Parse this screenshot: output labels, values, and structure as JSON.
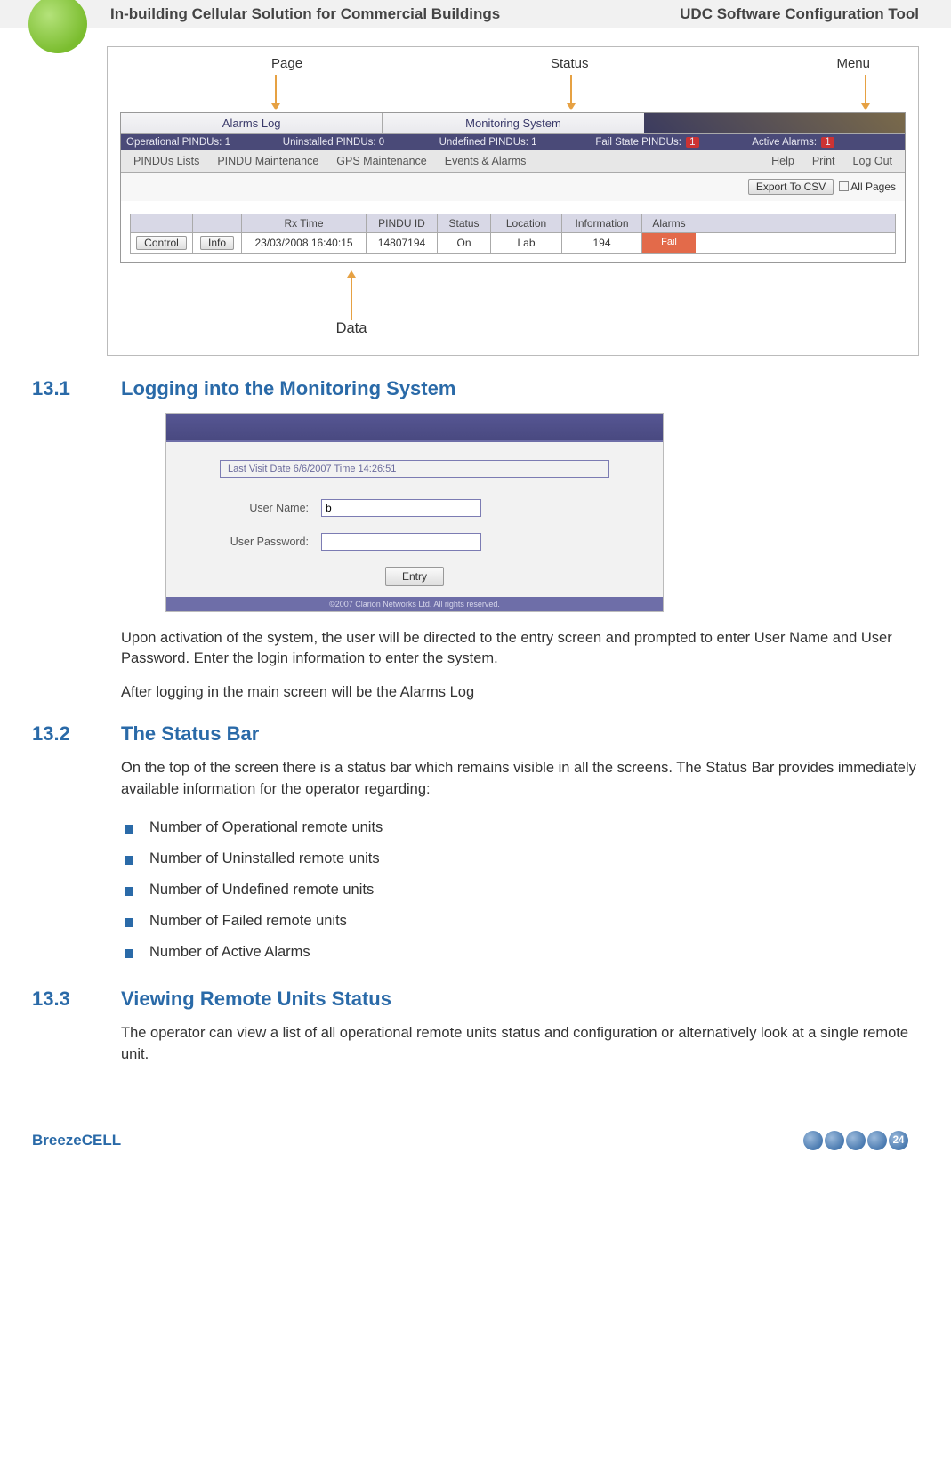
{
  "header": {
    "left": "In-building Cellular Solution for Commercial Buildings",
    "right": "UDC Software Configuration Tool"
  },
  "figure1": {
    "callouts": {
      "c1": "Page",
      "c2": "Status",
      "c3": "Menu",
      "c4": "Data"
    },
    "pageTabs": {
      "a": "Alarms Log",
      "b": "Monitoring System"
    },
    "status": {
      "s1": "Operational PINDUs:  1",
      "s2": "Uninstalled  PINDUs:  0",
      "s3": "Undefined  PINDUs:  1",
      "s4": "Fail State  PINDUs:",
      "s5": "Active Alarms:"
    },
    "menu": [
      "PINDUs Lists",
      "PINDU Maintenance",
      "GPS Maintenance",
      "Events & Alarms",
      "Help",
      "Print",
      "Log Out"
    ],
    "toolbar": {
      "export": "Export To CSV",
      "allpages": "All Pages"
    },
    "grid": {
      "headers": [
        "",
        "",
        "Rx Time",
        "PINDU ID",
        "Status",
        "Location",
        "Information",
        "Alarms"
      ],
      "row": {
        "btn1": "Control",
        "btn2": "Info",
        "rx": "23/03/2008 16:40:15",
        "id": "14807194",
        "status": "On",
        "loc": "Lab",
        "info": "194",
        "alarm": "Fail"
      }
    }
  },
  "sec131": {
    "num": "13.1",
    "title": "Logging into the Monitoring System",
    "login": {
      "notice": "Last Visit Date  6/6/2007 Time 14:26:51",
      "userLabel": "User Name:",
      "userVal": "b",
      "passLabel": "User Password:",
      "entry": "Entry",
      "footer": "©2007 Clarion Networks Ltd. All rights reserved."
    },
    "p1": "Upon activation of the system, the user will be directed to the entry screen and prompted to enter User Name and User Password. Enter the login information to enter the system.",
    "p2": "After logging in the main screen will be the Alarms Log"
  },
  "sec132": {
    "num": "13.2",
    "title": "The Status Bar",
    "p1": "On the top of the screen there is a status bar which remains visible in all the screens. The Status Bar provides immediately available information for the operator regarding:",
    "bullets": [
      "Number of Operational remote units",
      "Number of Uninstalled remote units",
      "Number of Undefined remote units",
      "Number of Failed remote units",
      "Number of Active Alarms"
    ]
  },
  "sec133": {
    "num": "13.3",
    "title": "Viewing Remote Units Status",
    "p1": "The operator can view a list of all operational remote units status and configuration or alternatively look at a single remote unit."
  },
  "footer": {
    "brand": "BreezeCELL",
    "page": "24"
  }
}
